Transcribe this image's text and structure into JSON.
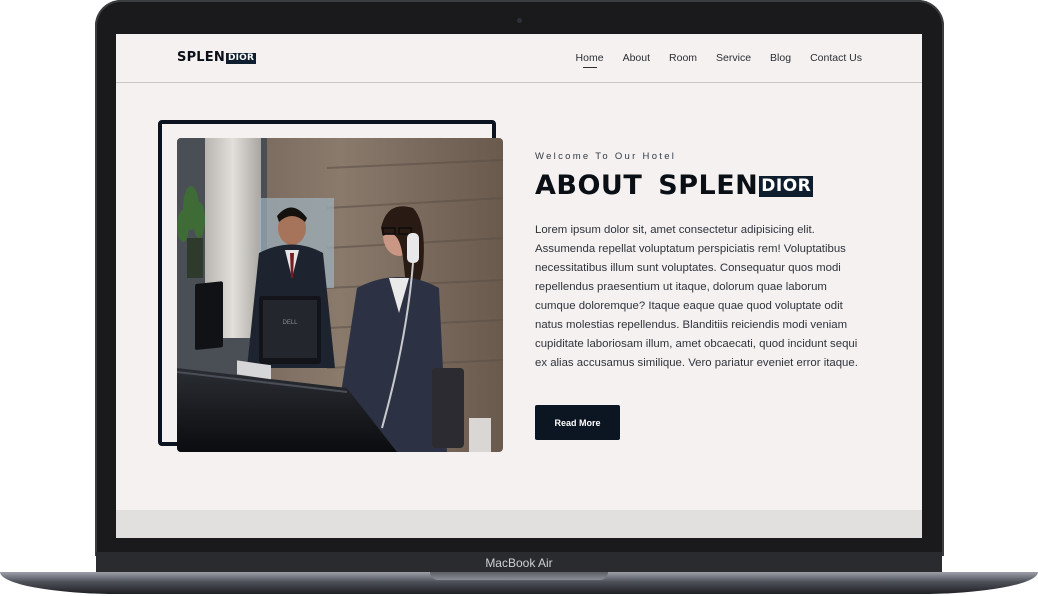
{
  "device": {
    "label": "MacBook Air"
  },
  "site": {
    "logo": {
      "text": "SPLEN",
      "badge": "DIOR"
    },
    "nav": [
      {
        "label": "Home",
        "active": true
      },
      {
        "label": "About",
        "active": false
      },
      {
        "label": "Room",
        "active": false
      },
      {
        "label": "Service",
        "active": false
      },
      {
        "label": "Blog",
        "active": false
      },
      {
        "label": "Contact Us",
        "active": false
      }
    ]
  },
  "about": {
    "eyebrow": "Welcome To Our Hotel",
    "heading_word1": "ABOUT",
    "heading_word2": "SPLEN",
    "heading_badge": "DIOR",
    "paragraph": "Lorem ipsum dolor sit, amet consectetur adipisicing elit. Assumenda repellat voluptatum perspiciatis rem! Voluptatibus necessitatibus illum sunt voluptates. Consequatur quos modi repellendus praesentium ut itaque, dolorum quae laborum cumque doloremque? Itaque eaque quae quod voluptate odit natus molestias repellendus. Blanditiis reiciendis modi veniam cupiditate laboriosam illum, amet obcaecati, quod incidunt sequi ex alias accusamus similique. Vero pariatur eveniet error itaque.",
    "button_label": "Read More"
  },
  "colors": {
    "accent": "#0e1e2e",
    "background": "#f4f1f0",
    "text": "#2f333b"
  }
}
